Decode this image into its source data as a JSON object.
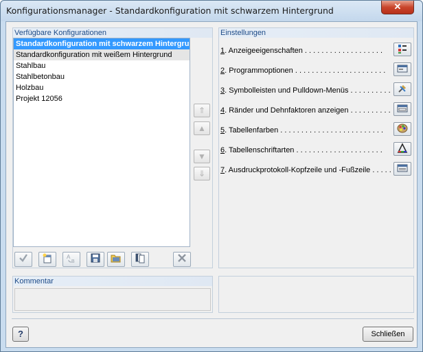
{
  "window": {
    "title": "Konfigurationsmanager - Standardkonfiguration mit schwarzem Hintergrund",
    "close_glyph": "✕"
  },
  "left_panel": {
    "header": "Verfügbare Konfigurationen",
    "items": [
      "Standardkonfiguration mit schwarzem Hintergrund",
      "Standardkonfiguration mit weißem Hintergrund",
      "Stahlbau",
      "Stahlbetonbau",
      "Holzbau",
      "Projekt 12056"
    ],
    "selected_index": 0,
    "arrows": {
      "top": "⇑",
      "up": "▲",
      "down": "▼",
      "bottom": "⇓"
    },
    "toolbar_icons": [
      "checkmark-icon",
      "new-config-icon",
      "rename-icon",
      "save-icon",
      "open-folder-icon",
      "copy-icon",
      "delete-icon"
    ]
  },
  "right_panel": {
    "header": "Einstellungen",
    "settings": [
      {
        "num": "1",
        "label": ". Anzeigeeigenschaften . . . . . . . . . . . . . . . . . . .",
        "icon": "display-properties-icon"
      },
      {
        "num": "2",
        "label": ". Programmoptionen . . . . . . . . . . . . . . . . . . . . . .",
        "icon": "program-options-icon"
      },
      {
        "num": "3",
        "label": ". Symbolleisten und Pulldown-Menüs . . . . . . . . . . .",
        "icon": "toolbars-icon"
      },
      {
        "num": "4",
        "label": ". Ränder und Dehnfaktoren anzeigen . . . . . . . . . .",
        "icon": "margins-icon"
      },
      {
        "num": "5",
        "label": ". Tabellenfarben . . . . . . . . . . . . . . . . . . . . . . . . .",
        "icon": "table-colors-icon"
      },
      {
        "num": "6",
        "label": ". Tabellenschriftarten . . . . . . . . . . . . . . . . . . . . .",
        "icon": "table-fonts-icon"
      },
      {
        "num": "7",
        "label": ". Ausdruckprotokoll-Kopfzeile und -Fußzeile . . . . . .",
        "icon": "printout-header-icon"
      }
    ]
  },
  "comment": {
    "header": "Kommentar",
    "value": ""
  },
  "footer": {
    "help_label": "?",
    "close_label": "Schließen"
  }
}
